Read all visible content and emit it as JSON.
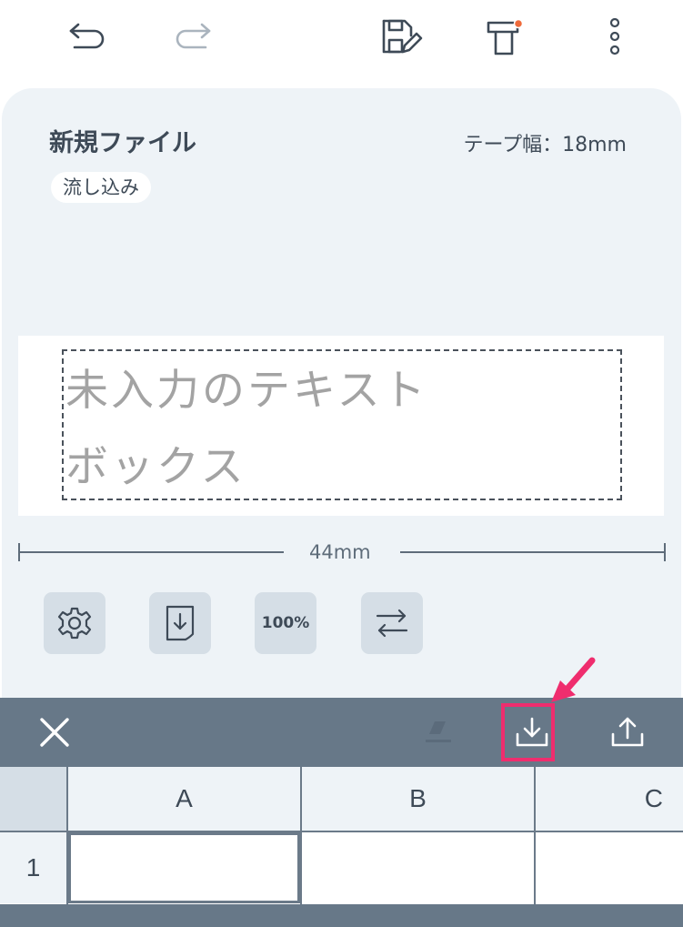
{
  "toolbar": {
    "undo_icon": "undo-arrow-icon",
    "redo_icon": "redo-arrow-icon",
    "save_icon": "save-edit-icon",
    "print_icon": "label-print-icon",
    "more_icon": "vertical-ellipsis-icon",
    "redo_disabled": true
  },
  "editor": {
    "file_title": "新規ファイル",
    "tape_width": "テープ幅：18mm",
    "flow_badge": "流し込み",
    "textbox_lines": [
      "未入力のテキスト",
      "ボックス"
    ],
    "length_label": "44mm",
    "tools": [
      {
        "name": "settings",
        "icon": "gear-icon"
      },
      {
        "name": "import",
        "icon": "document-download-icon"
      },
      {
        "name": "zoom",
        "label": "100%"
      },
      {
        "name": "direction",
        "icon": "swap-arrows-icon"
      }
    ]
  },
  "action_bar": {
    "close_icon": "close-icon",
    "eraser_icon": "eraser-icon",
    "download_icon": "download-tray-icon",
    "upload_icon": "upload-tray-icon",
    "highlight_color": "#ef2d6e"
  },
  "sheet": {
    "columns": [
      "A",
      "B",
      "C"
    ],
    "rows": [
      "1"
    ]
  },
  "colors": {
    "bar": "#677888",
    "panel": "#eef3f7",
    "button": "#d5dee6",
    "accent": "#ef2d6e",
    "text": "#3e4a57"
  }
}
